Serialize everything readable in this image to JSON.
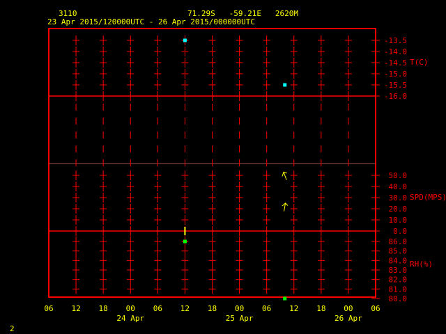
{
  "header": {
    "station": "3110",
    "location": "71.29S   -59.21E   2620M",
    "time_range": "23 Apr 2015/120000UTC - 26 Apr 2015/000000UTC"
  },
  "footer": {
    "page": "2"
  },
  "colors": {
    "frame": "#ff0000",
    "text": "#ffff00",
    "temperature": "#00ffff",
    "rh": "#00ff00",
    "wind": "#ffff00"
  },
  "chart_data": [
    {
      "type": "scatter",
      "ylabel": "T(C)",
      "ylim": [
        -16.0,
        -13.5
      ],
      "y_ticks": [
        "-13.5",
        "-14.0",
        "-14.5",
        "-15.0",
        "-15.5",
        "-16.0"
      ],
      "points": [
        {
          "time": "24 Apr 12",
          "hours": 30,
          "value": -13.5
        },
        {
          "time": "25 Apr 10",
          "hours": 52,
          "value": -15.5
        }
      ]
    },
    {
      "type": "scatter",
      "ylabel": "SPD(MPS)",
      "ylim": [
        0,
        50
      ],
      "y_ticks": [
        "50.0",
        "40.0",
        "30.0",
        "20.0",
        "10.0",
        "0.0"
      ],
      "points": [
        {
          "time": "24 Apr 12",
          "hours": 30,
          "value": 0,
          "direction": 0
        },
        {
          "time": "25 Apr 10",
          "hours": 52,
          "value": 50,
          "direction": 340
        },
        {
          "time": "25 Apr 10",
          "hours": 52,
          "value": 22,
          "direction": 10
        }
      ]
    },
    {
      "type": "scatter",
      "ylabel": "RH(%)",
      "ylim": [
        80,
        86
      ],
      "y_ticks": [
        "86.0",
        "85.0",
        "84.0",
        "83.0",
        "82.0",
        "81.0",
        "80.0"
      ],
      "points": [
        {
          "time": "24 Apr 12",
          "hours": 30,
          "value": 86
        },
        {
          "time": "25 Apr 10",
          "hours": 52,
          "value": 80
        }
      ]
    }
  ],
  "x_axis": {
    "hour_ticks": [
      "06",
      "12",
      "18",
      "00",
      "06",
      "12",
      "18",
      "00",
      "06",
      "12",
      "18",
      "00",
      "06"
    ],
    "day_labels": [
      {
        "label": "24 Apr",
        "hours": 18
      },
      {
        "label": "25 Apr",
        "hours": 42
      },
      {
        "label": "26 Apr",
        "hours": 66
      }
    ]
  }
}
